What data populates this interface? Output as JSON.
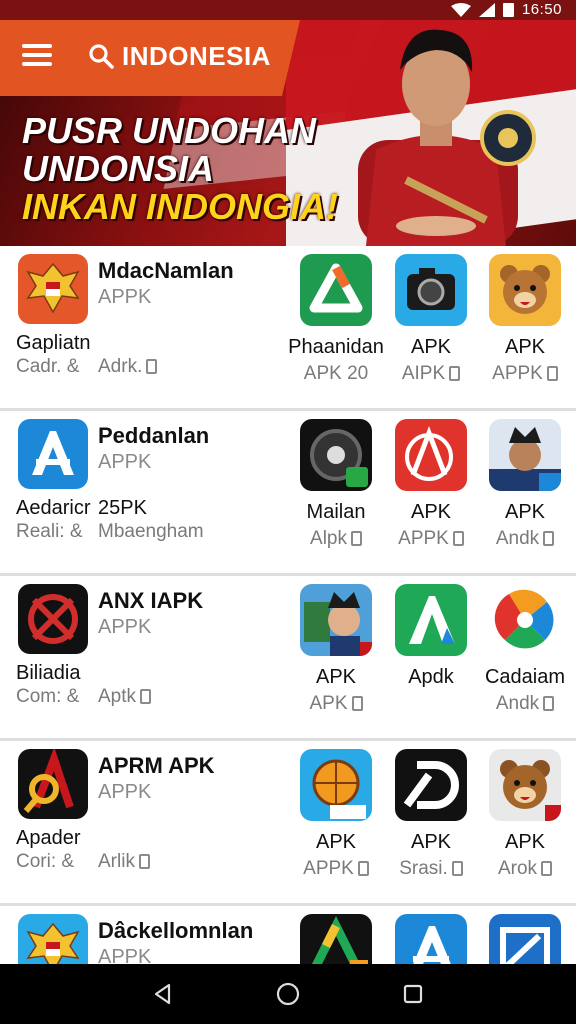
{
  "status_bar": {
    "time": "16:50"
  },
  "header": {
    "search_text": "INDONESIA"
  },
  "hero": {
    "line1": "PUSR UNDOHAN",
    "line2": "UNDONSIA",
    "line3": "INKAN INDONGIA!"
  },
  "rows": [
    {
      "title": "MdacNamlan",
      "subtitle": "APPK",
      "name": "Gapliatn",
      "meta": "Cadr. &",
      "sec_name": "",
      "sec_meta": "Adrk.",
      "tiles": [
        {
          "name": "Phaanidan",
          "meta": "APK 20",
          "icon": "drive-triangle-icon"
        },
        {
          "name": "APK",
          "meta": "AIPK",
          "icon": "camera-icon"
        },
        {
          "name": "APK",
          "meta": "APPK",
          "icon": "bear-icon"
        }
      ]
    },
    {
      "title": "Peddanlan",
      "subtitle": "APPK",
      "name": "Aedaricr",
      "meta": "Reali: &",
      "sec_name": "25PK",
      "sec_meta": "Mbaengham",
      "tiles": [
        {
          "name": "Mailan",
          "meta": "Alpk",
          "icon": "wheel-icon"
        },
        {
          "name": "APK",
          "meta": "APPK",
          "icon": "red-a-icon"
        },
        {
          "name": "APK",
          "meta": "Andk",
          "icon": "official-portrait-icon"
        }
      ]
    },
    {
      "title": "ANX IAPK",
      "subtitle": "APPK",
      "name": "Biliadia",
      "meta": "Com: &",
      "sec_name": "",
      "sec_meta": "Aptk",
      "tiles": [
        {
          "name": "APK",
          "meta": "APK",
          "icon": "poster-icon"
        },
        {
          "name": "Apdk",
          "meta": "",
          "icon": "green-a-icon"
        },
        {
          "name": "Cadaiam",
          "meta": "Andk",
          "icon": "pinwheel-icon"
        }
      ]
    },
    {
      "title": "APRM APK",
      "subtitle": "APPK",
      "name": "Apader",
      "meta": "Cori: &",
      "sec_name": "",
      "sec_meta": "Arlik",
      "tiles": [
        {
          "name": "APK",
          "meta": "APPK",
          "icon": "globe-ball-icon"
        },
        {
          "name": "APK",
          "meta": "Srasi.",
          "icon": "black-d-icon"
        },
        {
          "name": "APK",
          "meta": "Arok",
          "icon": "bear-icon"
        }
      ]
    },
    {
      "title": "Dâckellomnlan",
      "subtitle": "APPK",
      "tiles": [
        {
          "icon": "drive-5-icon"
        },
        {
          "icon": "blue-a-icon"
        },
        {
          "icon": "blue-square-icon"
        }
      ]
    }
  ],
  "colors": {
    "accent": "#e25422",
    "hero_dark": "#7a1212",
    "flag_red": "#c8161d"
  }
}
